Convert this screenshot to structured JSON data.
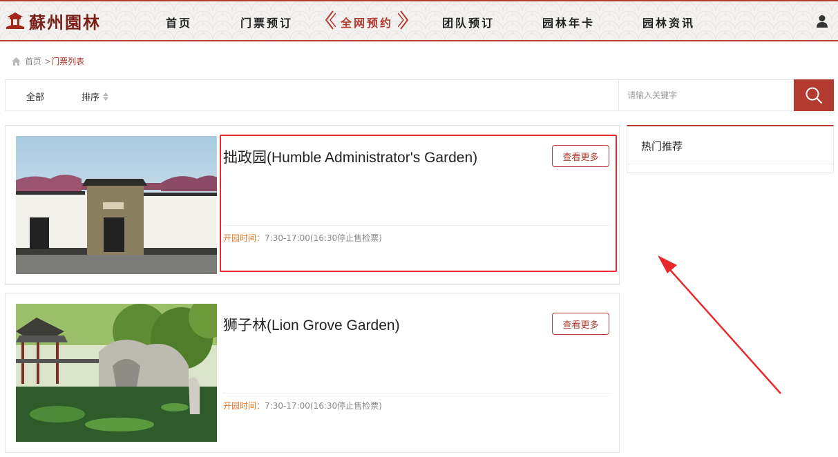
{
  "brand": {
    "name": "蘇州園林",
    "logo_icon": "pavilion-logo-icon"
  },
  "nav": {
    "items": [
      {
        "label": "首页",
        "active": false
      },
      {
        "label": "门票预订",
        "active": false
      },
      {
        "label": "全网预约",
        "active": true
      },
      {
        "label": "团队预订",
        "active": false
      },
      {
        "label": "园林年卡",
        "active": false
      },
      {
        "label": "园林资讯",
        "active": false
      }
    ],
    "user_icon": "user-icon"
  },
  "breadcrumb": {
    "home": "首页",
    "separator": ">",
    "current": "门票列表"
  },
  "filter": {
    "all_label": "全部",
    "sort_label": "排序",
    "search_placeholder": "请输入关键字",
    "search_value": ""
  },
  "listings": [
    {
      "title": "拙政园(Humble Administrator's Garden)",
      "more_label": "查看更多",
      "hours_label": "开园时间：",
      "hours_value": "7:30-17:00(16:30停止售检票)"
    },
    {
      "title": "狮子林(Lion Grove Garden)",
      "more_label": "查看更多",
      "hours_label": "开园时间：",
      "hours_value": "7:30-17:00(16:30停止售检票)"
    }
  ],
  "sidebar": {
    "title": "热门推荐"
  },
  "colors": {
    "brand_red": "#b23a2e",
    "annotation_red": "#e8292b",
    "hours_orange": "#e07a2b"
  }
}
